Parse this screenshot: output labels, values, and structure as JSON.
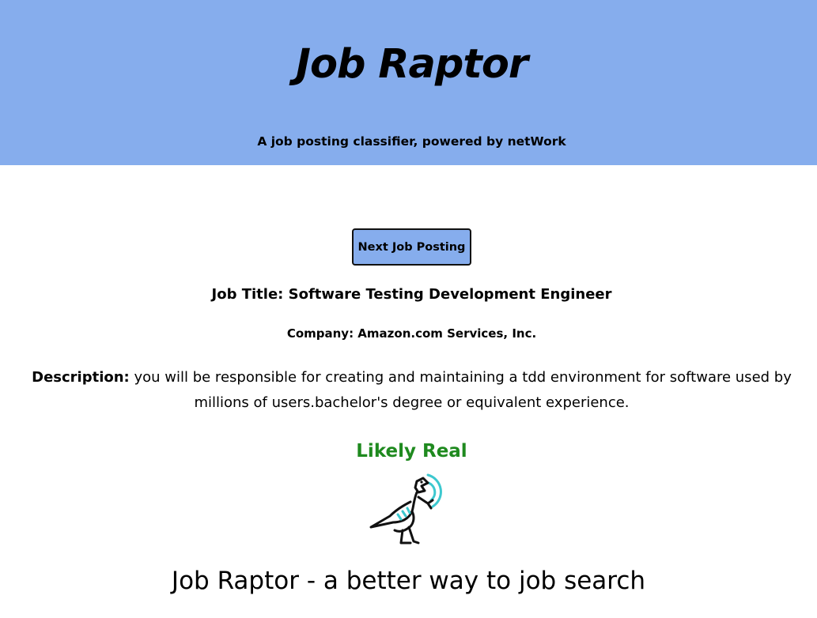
{
  "header": {
    "title": "Job Raptor",
    "subtitle": "A job posting classifier, powered by netWork"
  },
  "actions": {
    "next_label": "Next Job Posting"
  },
  "posting": {
    "title_text": "Job Title: Software Testing Development Engineer",
    "company_text": "Company: Amazon.com Services, Inc.",
    "description_label": "Description:",
    "description_text": " you will be responsible for creating and maintaining a tdd environment for software used by millions of users.bachelor's degree or equivalent experience."
  },
  "result": {
    "verdict": "Likely Real",
    "verdict_color": "#1f8a1f",
    "icon": "raptor-icon"
  },
  "footer": {
    "tagline": "Job Raptor - a better way to job search"
  },
  "colors": {
    "header_bg": "#86aded",
    "button_bg": "#86aded",
    "raptor_accent": "#3cc8cf"
  }
}
